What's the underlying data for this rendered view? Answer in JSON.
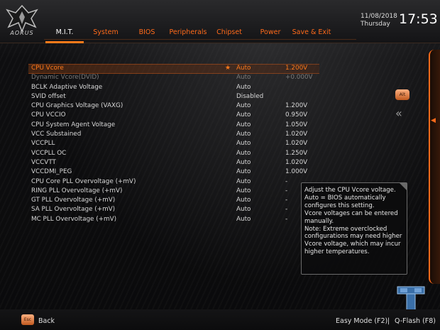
{
  "brand": {
    "logo_text": "AORUS",
    "accent": "#ff7a1a"
  },
  "tabs": [
    {
      "label": "M.I.T.",
      "active": true
    },
    {
      "label": "System"
    },
    {
      "label": "BIOS"
    },
    {
      "label": "Peripherals"
    },
    {
      "label": "Chipset"
    },
    {
      "label": "Power"
    },
    {
      "label": "Save & Exit"
    }
  ],
  "clock": {
    "date": "11/08/2018",
    "day": "Thursday",
    "time": "17:53"
  },
  "settings": [
    {
      "label": "CPU Vcore",
      "value": "Auto",
      "voltage": "1.200V",
      "selected": true
    },
    {
      "label": "Dynamic Vcore(DVID)",
      "value": "Auto",
      "voltage": "+0.000V",
      "dim": true
    },
    {
      "label": "BCLK Adaptive Voltage",
      "value": "Auto",
      "voltage": ""
    },
    {
      "label": "SVID offset",
      "value": "Disabled",
      "voltage": ""
    },
    {
      "label": "CPU Graphics Voltage (VAXG)",
      "value": "Auto",
      "voltage": "1.200V"
    },
    {
      "label": "CPU VCCIO",
      "value": "Auto",
      "voltage": "0.950V"
    },
    {
      "label": "CPU System Agent Voltage",
      "value": "Auto",
      "voltage": "1.050V"
    },
    {
      "label": "VCC Substained",
      "value": "Auto",
      "voltage": "1.020V"
    },
    {
      "label": "VCCPLL",
      "value": "Auto",
      "voltage": "1.020V"
    },
    {
      "label": "VCCPLL OC",
      "value": "Auto",
      "voltage": "1.250V"
    },
    {
      "label": "VCCVTT",
      "value": "Auto",
      "voltage": "1.020V"
    },
    {
      "label": "VCCDMI_PEG",
      "value": "Auto",
      "voltage": "1.000V"
    },
    {
      "label": "CPU Core PLL Overvoltage (+mV)",
      "value": "Auto",
      "voltage": "-"
    },
    {
      "label": "RING PLL Overvoltage (+mV)",
      "value": "Auto",
      "voltage": "-"
    },
    {
      "label": "GT PLL Overvoltage (+mV)",
      "value": "Auto",
      "voltage": "-"
    },
    {
      "label": "SA PLL Overvoltage (+mV)",
      "value": "Auto",
      "voltage": "-"
    },
    {
      "label": "MC PLL Overvoltage (+mV)",
      "value": "Auto",
      "voltage": "-"
    }
  ],
  "help_text": "Adjust the CPU Vcore voltage.\nAuto = BIOS automatically configures this setting.\nVcore voltages can be entered manually.\nNote: Extreme overclocked configurations may need higher Vcore voltage, which may incur higher temperatures.",
  "alt_key": "Alt",
  "esc_key": "Esc",
  "footer": {
    "back": "Back",
    "easy_mode": "Easy Mode (F2)",
    "separator": "|",
    "qflash": "Q-Flash (F8)"
  },
  "icons": {
    "favorite": "star-icon",
    "collapse": "double-chevron-left-icon",
    "logo": "aorus-eagle-icon"
  }
}
